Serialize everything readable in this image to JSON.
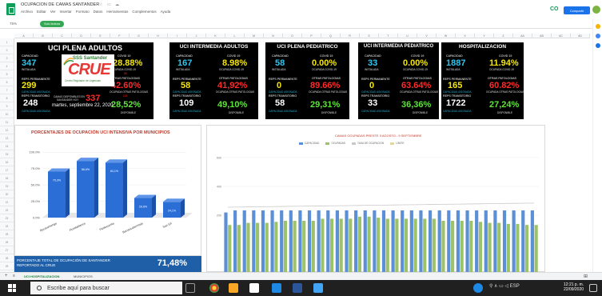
{
  "titlebar": {
    "doc_title": "OCUPACION DE CAMAS SANTANDER",
    "menu": [
      "Archivo",
      "Editar",
      "Ver",
      "Insertar",
      "Formato",
      "Datos",
      "Herramientas",
      "Complementos",
      "Ayuda"
    ],
    "share_label": "Compartir",
    "zoom": "75%",
    "toolbar_pill": "Solo lectura"
  },
  "columns": [
    "A",
    "B",
    "C",
    "D",
    "E",
    "F",
    "G",
    "H",
    "I",
    "J",
    "K",
    "L",
    "M",
    "N",
    "O",
    "P",
    "Q",
    "R",
    "S",
    "T",
    "U",
    "V",
    "W",
    "X",
    "Y",
    "Z",
    "AA",
    "AB",
    "AC",
    "AD"
  ],
  "rows": [
    "1",
    "2",
    "3",
    "4",
    "5",
    "6",
    "7",
    "8",
    "9",
    "10",
    "11",
    "12",
    "13",
    "14",
    "15",
    "16",
    "17",
    "18",
    "19",
    "20",
    "21",
    "22",
    "23",
    "24",
    "25",
    "26",
    "27",
    "28",
    "29"
  ],
  "blocks": {
    "adultos": {
      "title": "UCI PLENA ADULTOS",
      "capacidad_label": "CAPACIDAD",
      "capacidad_sub": "INSTALADA",
      "capacidad": "347",
      "covid_label": "COVID 19",
      "covid_pct": "28.88%",
      "covid_sub": "OCUPADA COVID-19",
      "camas_covid": "99",
      "otras_label": "OTRAS PATOLOGIAS",
      "otras_pct": "42.60%",
      "otras_sub": "OCUPADA OTRAS PATOLOGIAS",
      "camas_otras": "143",
      "mod_label": "REPS PERMANENTE",
      "mod": "299",
      "trans_label": "REPS TRANSITORIO",
      "trans": "248",
      "asig_label": "CAPACIDAD ASIGNADA",
      "date_line1": "CAMAS DISPONIBLES EN",
      "date_line2": "SANTANDER HOY",
      "date_val": "337",
      "date": "martes, septiembre 22, 2020",
      "libre_pct": "28,52%",
      "libre_sub": "DISPONIBLE"
    },
    "intermedia_adultos": {
      "title": "UCI INTERMEDIA ADULTOS",
      "capacidad": "167",
      "covid_pct": "8.98%",
      "otras_pct": "41,92%",
      "mod": "58",
      "trans": "109",
      "libre_pct": "49,10%"
    },
    "pediatrico": {
      "title": "UCI PLENA PEDIATRICO",
      "capacidad": "58",
      "covid_pct": "0.00%",
      "otras_pct": "89.66%",
      "mod": "0",
      "trans": "58",
      "libre_pct": "29,31%"
    },
    "intermedia_pediatrico": {
      "title": "UCI INTERMEDIA PEDIATRICO",
      "capacidad": "33",
      "covid_pct": "0.00%",
      "otras_pct": "63.64%",
      "mod": "0",
      "trans": "33",
      "libre_pct": "36,36%"
    },
    "hospitalizacion": {
      "title": "HOSPITALIZACION",
      "capacidad": "1887",
      "covid_pct": "11.94%",
      "otras_pct": "60.82%",
      "mod": "165",
      "trans": "1722",
      "libre_pct": "27,24%"
    }
  },
  "logo": {
    "line1": "SSS Santander",
    "line2": "CRUE",
    "line3": "Centro Regulador de Urgencias"
  },
  "chart_data": [
    {
      "type": "bar",
      "title": "PORCENTAJES DE OCUPACIÓN UCI INTENSIVA POR MUNICIPIOS",
      "categories": [
        "Bucaramanga",
        "Floridablanca",
        "Piedecuesta",
        "Barrancabermeja",
        "San Gil"
      ],
      "values": [
        70.3,
        86.6,
        84.1,
        29.9,
        24.1
      ],
      "data_labels": [
        "70,3%",
        "86,6%",
        "84,1%",
        "29,9%",
        "24,1%"
      ],
      "yticks": [
        "100.0%",
        "75.0%",
        "50.0%",
        "25.0%",
        "0.0%"
      ],
      "ylim": [
        0,
        110
      ],
      "color": "#2b6fd6"
    },
    {
      "type": "bar",
      "title": "CAMAS OCUPADAS PRESTE 3 AGOSTO - 9 SEPTIEMBRE",
      "series": [
        {
          "name": "CAPACIDAD",
          "color": "#5b8fd6"
        },
        {
          "name": "OCUPADAS",
          "color": "#9dc36a"
        },
        {
          "name": "TASA DE OCUPACION",
          "color": "#c9c9c9"
        },
        {
          "name": "LIMITE",
          "color": "#e0d7a0"
        }
      ],
      "n_days": 34,
      "blue_values": [
        58,
        60,
        60,
        60,
        60,
        60,
        60,
        60,
        60,
        60,
        60,
        60,
        60,
        60,
        60,
        60,
        60,
        60,
        60,
        60,
        60,
        60,
        60,
        60,
        60,
        60,
        60,
        60,
        60,
        60,
        60,
        60,
        60,
        60
      ],
      "green_values": [
        46,
        46,
        48,
        48,
        48,
        49,
        50,
        50,
        50,
        50,
        52,
        52,
        52,
        52,
        54,
        54,
        53,
        52,
        52,
        52,
        52,
        52,
        52,
        50,
        50,
        50,
        50,
        49,
        48,
        48,
        47,
        47,
        46,
        46
      ],
      "yticks": [
        "600",
        "400",
        "200"
      ],
      "ylim": [
        0,
        100
      ]
    }
  ],
  "footer": {
    "text": "PORCENTAJE TOTAL DE OCUPACIÓN DE SANTANDER REPORTADO AL CRUE",
    "value": "71,48%"
  },
  "sheet_tabs": [
    "UCI HOSPITALIZACION",
    "MUNICIPIOS"
  ],
  "taskbar": {
    "search_placeholder": "Escribe aquí para buscar",
    "lang": "ESP",
    "time": "12:21 p. m.",
    "date": "22/09/2020"
  }
}
